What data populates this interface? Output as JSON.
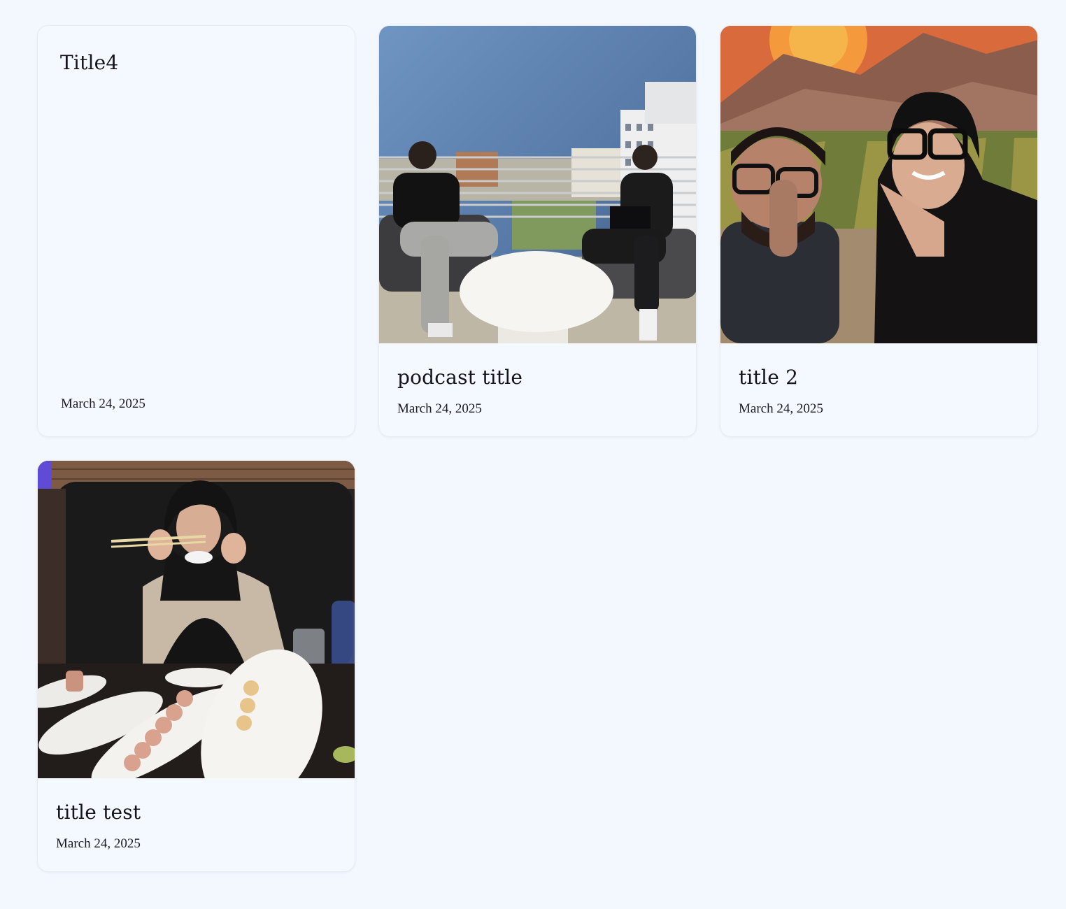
{
  "posts": [
    {
      "title": "Title4",
      "date": "March 24, 2025",
      "image": ""
    },
    {
      "title": "podcast title",
      "date": "March 24, 2025",
      "image": "two-men-seated-on-rooftop-balcony-photo"
    },
    {
      "title": "title 2",
      "date": "March 24, 2025",
      "image": "selfie-of-two-people-by-mural-photo"
    },
    {
      "title": "title test",
      "date": "March 24, 2025",
      "image": "woman-with-chopsticks-and-sushi-photo"
    }
  ],
  "colors": {
    "page_background": "#f3f7fe",
    "card_background": "#f4f8ff",
    "card_border": "#e7ebf2",
    "text": "#14141a"
  }
}
